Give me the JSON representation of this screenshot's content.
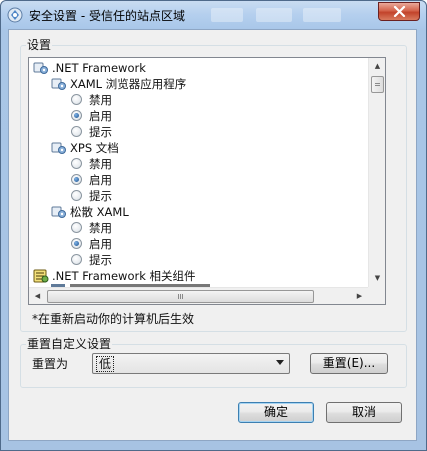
{
  "window": {
    "title": "安全设置 - 受信任的站点区域"
  },
  "settings_group": {
    "label": "设置"
  },
  "tree": {
    "items": [
      {
        "kind": "category",
        "label": ".NET Framework",
        "icon": "settings-gear-icon"
      },
      {
        "kind": "setting",
        "label": "XAML 浏览器应用程序",
        "icon": "settings-gear-icon"
      },
      {
        "kind": "option",
        "label": "禁用",
        "checked": false
      },
      {
        "kind": "option",
        "label": "启用",
        "checked": true
      },
      {
        "kind": "option",
        "label": "提示",
        "checked": false
      },
      {
        "kind": "setting",
        "label": "XPS 文档",
        "icon": "settings-gear-icon"
      },
      {
        "kind": "option",
        "label": "禁用",
        "checked": false
      },
      {
        "kind": "option",
        "label": "启用",
        "checked": true
      },
      {
        "kind": "option",
        "label": "提示",
        "checked": false
      },
      {
        "kind": "setting",
        "label": "松散 XAML",
        "icon": "settings-gear-icon"
      },
      {
        "kind": "option",
        "label": "禁用",
        "checked": false
      },
      {
        "kind": "option",
        "label": "启用",
        "checked": true
      },
      {
        "kind": "option",
        "label": "提示",
        "checked": false
      },
      {
        "kind": "category",
        "label": ".NET Framework 相关组件",
        "icon": "framework-components-icon"
      }
    ]
  },
  "restart_note": "*在重新启动你的计算机后生效",
  "reset_group": {
    "label": "重置自定义设置",
    "reset_to_label": "重置为",
    "reset_level_value": "低",
    "reset_button": "重置(E)..."
  },
  "buttons": {
    "ok": "确定",
    "cancel": "取消"
  },
  "colors": {
    "titlebar": "#b4cfee",
    "dialog_background": "#f0f0f0",
    "close_button": "#c2432b",
    "radio_checked": "#1a4e8a"
  }
}
